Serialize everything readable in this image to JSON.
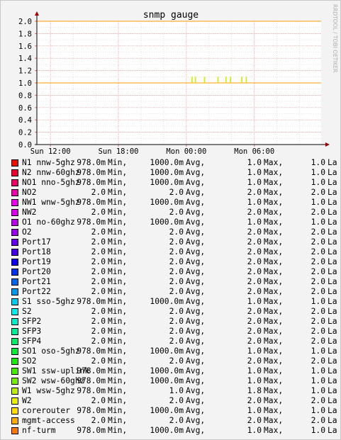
{
  "chart_data": {
    "type": "line",
    "title": "snmp gauge",
    "watermark": "RRDTOOL / TOBI OETIKER",
    "xlabel": "",
    "ylabel": "",
    "ylim": [
      0,
      2.0
    ],
    "y_ticks": [
      "2.0",
      "1.8",
      "1.6",
      "1.4",
      "1.2",
      "1.0",
      "0.8",
      "0.6",
      "0.4",
      "0.2",
      "0.0"
    ],
    "x_ticks": [
      "Sun 12:00",
      "Sun 18:00",
      "Mon 00:00",
      "Mon 06:00"
    ],
    "xlim_hours": [
      -1.2,
      23.9
    ],
    "x_tick_hours": [
      0,
      6,
      12,
      18
    ],
    "grid": true,
    "lines": [
      {
        "value": 2.0,
        "color": "#ff9900"
      },
      {
        "value": 1.0,
        "color": "#ff9900"
      }
    ],
    "spikes": {
      "color": "#ccee00",
      "base": 1.0,
      "top": 1.1,
      "at_hours": [
        12.5,
        12.8,
        13.6,
        14.8,
        15.5,
        15.9,
        16.9,
        17.3
      ]
    },
    "series": [
      {
        "name": "N1 nnw-5ghz",
        "color": "#ee1100",
        "min": "978.0m",
        "avg": "1000.0m",
        "max": "1.0",
        "last": "1.0"
      },
      {
        "name": "N2 nnw-60ghz",
        "color": "#ee0033",
        "min": "978.0m",
        "avg": "1000.0m",
        "max": "1.0",
        "last": "1.0"
      },
      {
        "name": "NO1 nno-5ghz",
        "color": "#ee0066",
        "min": "978.0m",
        "avg": "1000.0m",
        "max": "1.0",
        "last": "1.0"
      },
      {
        "name": "NO2",
        "color": "#ee00aa",
        "min": "2.0",
        "avg": "2.0",
        "max": "2.0",
        "last": "2.0"
      },
      {
        "name": "NW1 wnw-5ghz",
        "color": "#ee00ee",
        "min": "978.0m",
        "avg": "1000.0m",
        "max": "1.0",
        "last": "1.0"
      },
      {
        "name": "NW2",
        "color": "#dd00ee",
        "min": "2.0",
        "avg": "2.0",
        "max": "2.0",
        "last": "2.0"
      },
      {
        "name": "O1 no-60ghz",
        "color": "#bb00ee",
        "min": "978.0m",
        "avg": "1000.0m",
        "max": "1.0",
        "last": "1.0"
      },
      {
        "name": "O2",
        "color": "#9900ee",
        "min": "2.0",
        "avg": "2.0",
        "max": "2.0",
        "last": "2.0"
      },
      {
        "name": "Port17",
        "color": "#6600ee",
        "min": "2.0",
        "avg": "2.0",
        "max": "2.0",
        "last": "2.0"
      },
      {
        "name": "Port18",
        "color": "#4400ee",
        "min": "2.0",
        "avg": "2.0",
        "max": "2.0",
        "last": "2.0"
      },
      {
        "name": "Port19",
        "color": "#1100ee",
        "min": "2.0",
        "avg": "2.0",
        "max": "2.0",
        "last": "2.0"
      },
      {
        "name": "Port20",
        "color": "#0033ee",
        "min": "2.0",
        "avg": "2.0",
        "max": "2.0",
        "last": "2.0"
      },
      {
        "name": "Port21",
        "color": "#0066ee",
        "min": "2.0",
        "avg": "2.0",
        "max": "2.0",
        "last": "2.0"
      },
      {
        "name": "Port22",
        "color": "#0099ee",
        "min": "2.0",
        "avg": "2.0",
        "max": "2.0",
        "last": "2.0"
      },
      {
        "name": "S1 sso-5ghz",
        "color": "#00ccee",
        "min": "978.0m",
        "avg": "1000.0m",
        "max": "1.0",
        "last": "1.0"
      },
      {
        "name": "S2",
        "color": "#00eeee",
        "min": "2.0",
        "avg": "2.0",
        "max": "2.0",
        "last": "2.0"
      },
      {
        "name": "SFP2",
        "color": "#00eecc",
        "min": "2.0",
        "avg": "2.0",
        "max": "2.0",
        "last": "2.0"
      },
      {
        "name": "SFP3",
        "color": "#00ee99",
        "min": "2.0",
        "avg": "2.0",
        "max": "2.0",
        "last": "2.0"
      },
      {
        "name": "SFP4",
        "color": "#00ee66",
        "min": "2.0",
        "avg": "2.0",
        "max": "2.0",
        "last": "2.0"
      },
      {
        "name": "SO1 oso-5ghz",
        "color": "#00ee33",
        "min": "978.0m",
        "avg": "1000.0m",
        "max": "1.0",
        "last": "1.0"
      },
      {
        "name": "SO2",
        "color": "#11ee00",
        "min": "2.0",
        "avg": "2.0",
        "max": "2.0",
        "last": "2.0"
      },
      {
        "name": "SW1 ssw-uplink",
        "color": "#44ee00",
        "min": "978.0m",
        "avg": "1000.0m",
        "max": "1.0",
        "last": "1.0"
      },
      {
        "name": "SW2 wsw-60ghz",
        "color": "#77ee00",
        "min": "978.0m",
        "avg": "1000.0m",
        "max": "1.0",
        "last": "1.0"
      },
      {
        "name": "W1 wsw-5ghz",
        "color": "#bbee00",
        "min": "978.0m",
        "avg": "1.0",
        "max": "1.8",
        "last": "1.0"
      },
      {
        "name": "W2",
        "color": "#eeee00",
        "min": "2.0",
        "avg": "2.0",
        "max": "2.0",
        "last": "2.0"
      },
      {
        "name": "corerouter",
        "color": "#ffdd00",
        "min": "978.0m",
        "avg": "1000.0m",
        "max": "1.0",
        "last": "1.0"
      },
      {
        "name": "mgmt-access",
        "color": "#ffaa00",
        "min": "2.0",
        "avg": "2.0",
        "max": "2.0",
        "last": "2.0"
      },
      {
        "name": "nf-turm",
        "color": "#ff7700",
        "min": "978.0m",
        "avg": "1000.0m",
        "max": "1.0",
        "last": "1.0"
      }
    ],
    "legend_labels": {
      "min": "Min,",
      "avg": "Avg,",
      "max": "Max,",
      "last": "La"
    }
  }
}
